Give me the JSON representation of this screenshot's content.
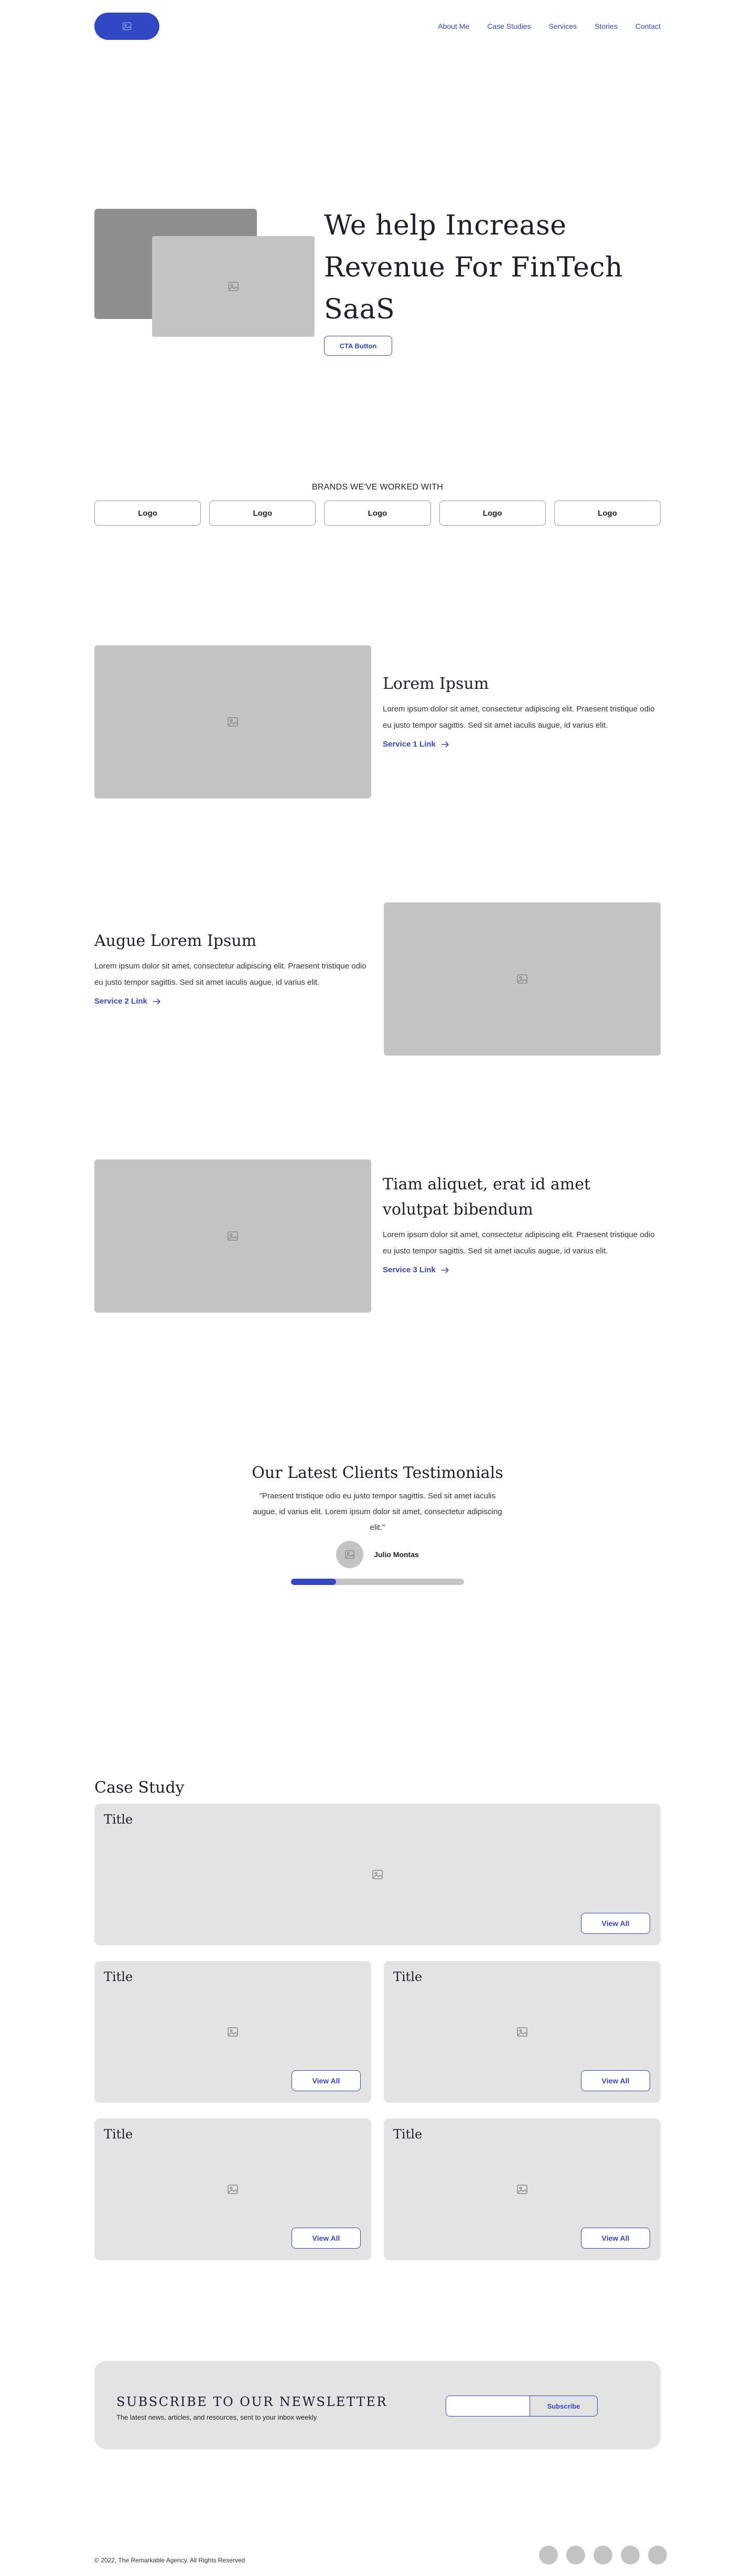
{
  "header": {
    "nav": [
      "About Me",
      "Case Studies",
      "Services",
      "Stories",
      "Contact"
    ]
  },
  "hero": {
    "title": "We help Increase Revenue For FinTech SaaS",
    "cta_label": "CTA Button"
  },
  "brands": {
    "title": "BRANDS WE'VE WORKED WITH",
    "logos": [
      "Logo",
      "Logo",
      "Logo",
      "Logo",
      "Logo"
    ]
  },
  "services": [
    {
      "title": "Lorem Ipsum",
      "body": "Lorem ipsum dolor sit amet, consectetur adipiscing elit. Praesent tristique odio eu justo tempor sagittis. Sed sit amet iaculis augue, id varius elit.",
      "link": "Service 1 Link"
    },
    {
      "title": "Augue Lorem Ipsum",
      "body": "Lorem ipsum dolor sit amet, consectetur adipiscing elit. Praesent tristique odio eu justo tempor sagittis. Sed sit amet iaculis augue, id varius elit.",
      "link": "Service 2 Link"
    },
    {
      "title": "Tiam aliquet, erat id amet volutpat bibendum",
      "body": "Lorem ipsum dolor sit amet, consectetur adipiscing elit. Praesent tristique odio eu justo tempor sagittis. Sed sit amet iaculis augue, id varius elit.",
      "link": "Service 3 Link"
    }
  ],
  "testimonials": {
    "title": "Our Latest Clients Testimonials",
    "quote": "\"Praesent tristique odio eu justo tempor sagittis. Sed sit amet iaculis augue, id varius elit. Lorem ipsum dolor sit amet, consectetur adipiscing elit.\"",
    "person": "Julio Montas",
    "progress_fraction": 0.26
  },
  "case_study": {
    "title": "Case Study",
    "cards": [
      {
        "title": "Title",
        "button": "View All"
      },
      {
        "title": "Title",
        "button": "View All"
      },
      {
        "title": "Title",
        "button": "View All"
      },
      {
        "title": "Title",
        "button": "View All"
      },
      {
        "title": "Title",
        "button": "View All"
      }
    ]
  },
  "newsletter": {
    "title": "SUBSCRIBE TO OUR NEWSLETTER",
    "subtitle": "The latest news, articles, and resources, sent to your inbox weekly",
    "input_value": "",
    "button": "Subscribe"
  },
  "footer": {
    "copyright": "© 2022, The Remarkable Agency. All Rights Reserved"
  },
  "colors": {
    "accent": "#3148c4",
    "placeholder_gray": "#c4c4c4",
    "card_bg": "#e3e3e3"
  }
}
